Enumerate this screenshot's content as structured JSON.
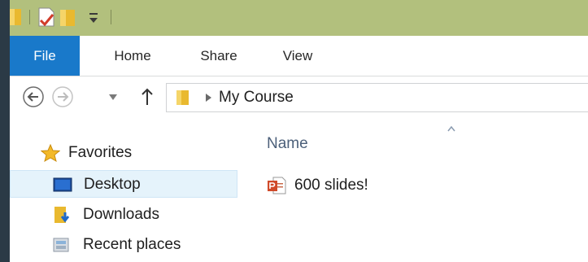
{
  "ribbon": {
    "tabs": [
      {
        "label": "File"
      },
      {
        "label": "Home"
      },
      {
        "label": "Share"
      },
      {
        "label": "View"
      }
    ]
  },
  "address": {
    "path": "My Course"
  },
  "navpane": {
    "favorites_label": "Favorites",
    "items": [
      {
        "label": "Desktop",
        "icon": "desktop-icon",
        "selected": true
      },
      {
        "label": "Downloads",
        "icon": "downloads-icon"
      },
      {
        "label": "Recent places",
        "icon": "recent-places-icon"
      }
    ]
  },
  "content": {
    "column_header": "Name",
    "files": [
      {
        "name": "600 slides!",
        "icon": "powerpoint-file-icon"
      }
    ]
  },
  "colors": {
    "titlebar": "#b2c07d",
    "file_tab": "#1979ca",
    "selected_item": "#e5f3fb"
  }
}
